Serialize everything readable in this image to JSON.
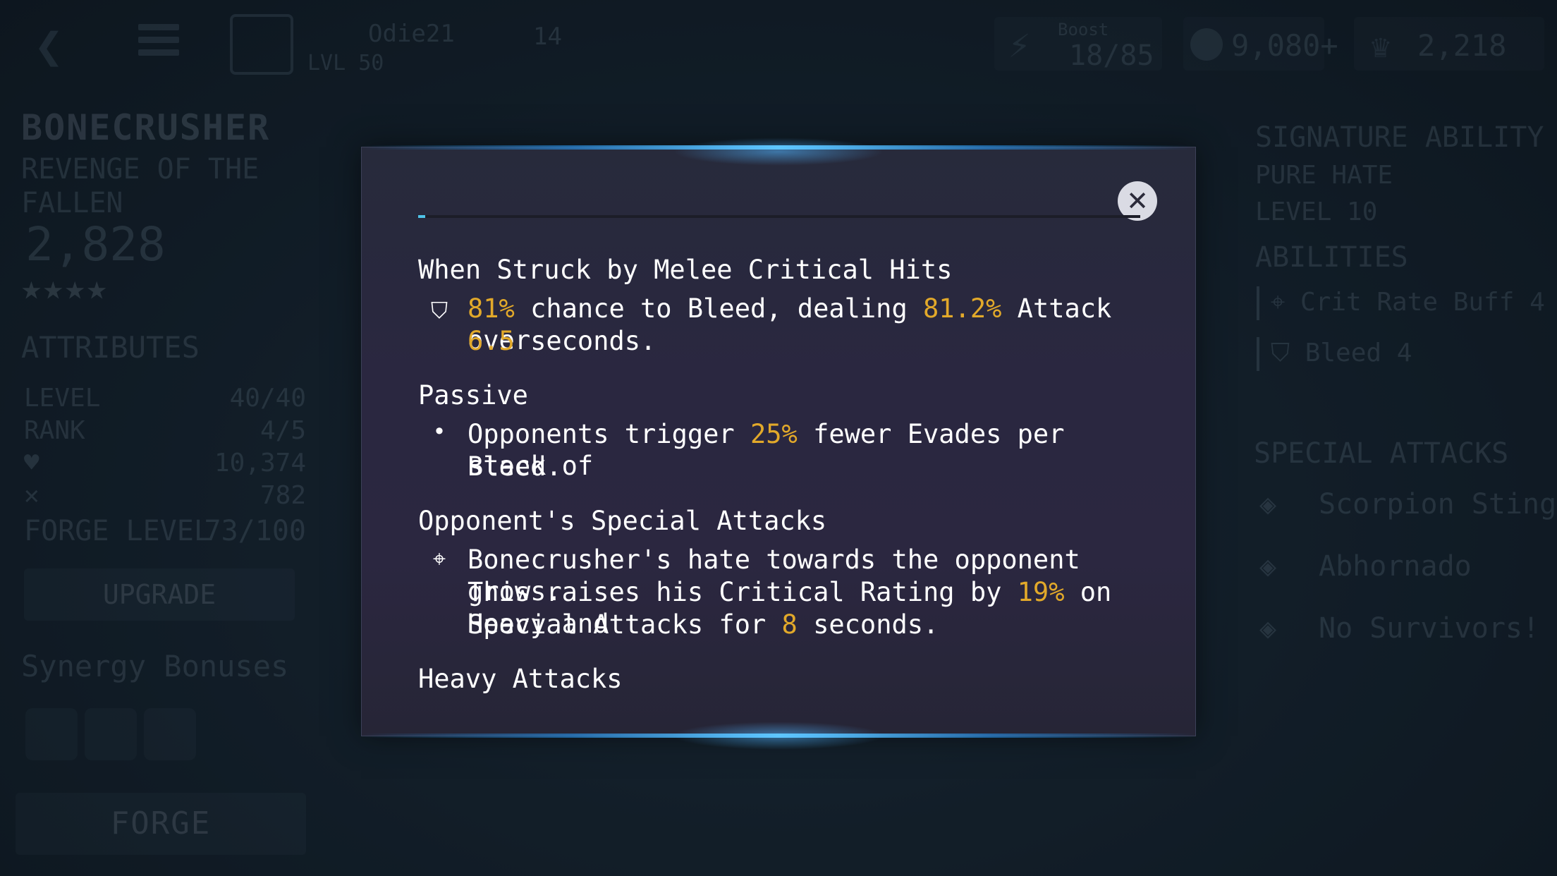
{
  "topbar": {
    "back_icon": "back-arrow-icon",
    "menu_icon": "menu-icon",
    "player_name": "Odie21",
    "player_level": "LVL 50",
    "player_number": "14",
    "energy": {
      "label": "Boost",
      "value": "18/85"
    },
    "gold_value": "9,080+",
    "units_value": "2,218"
  },
  "champion": {
    "name": "BONECRUSHER",
    "title": "REVENGE OF THE FALLEN",
    "power": "2,828",
    "stars": "★★★★",
    "attributes_title": "ATTRIBUTES",
    "attributes": [
      {
        "label": "LEVEL",
        "value": "40/40"
      },
      {
        "label": "RANK",
        "value": "4/5"
      },
      {
        "label": "♥",
        "value": "10,374"
      },
      {
        "label": "✕",
        "value": "782"
      }
    ],
    "forge_level_label": "FORGE LEVEL",
    "forge_level_value": "73/100",
    "upgrade_label": "UPGRADE",
    "synergy_title": "Synergy Bonuses",
    "forge_label": "FORGE"
  },
  "right_panel": {
    "signature_title": "SIGNATURE ABILITY",
    "signature_name": "PURE HATE",
    "signature_level": "LEVEL 10",
    "abilities_title": "ABILITIES",
    "abilities": [
      {
        "label": "Crit Rate Buff 4",
        "icon": "crosshair-icon"
      },
      {
        "label": "Bleed 4",
        "icon": "bleed-icon"
      }
    ],
    "special_title": "SPECIAL ATTACKS",
    "specials": [
      {
        "label": "Scorpion Sting"
      },
      {
        "label": "Abhornado"
      },
      {
        "label": "No Survivors!"
      }
    ]
  },
  "modal": {
    "close_icon": "close-icon",
    "sections": {
      "struck": {
        "title": "When Struck by Melee Critical Hits",
        "icon": "bleed-icon",
        "p1": "81%",
        "t1": " chance to Bleed, dealing ",
        "p2": "81.2%",
        "t2": " Attack over",
        "p3": "6.5",
        "t3": " seconds."
      },
      "passive": {
        "title": "Passive",
        "bullet": "•",
        "t1": "Opponents trigger ",
        "p1": "25%",
        "t2": " fewer Evades per stack of",
        "t3": "Bleed."
      },
      "specials": {
        "title": "Opponent's Special Attacks",
        "icon": "crosshair-icon",
        "line1": "Bonecrusher's hate towards the opponent grows.",
        "t2": "This raises his Critical Rating by ",
        "p1": "19%",
        "t3": " on Heavy and",
        "t4": "Special Attacks for ",
        "p2": "8",
        "t5": " seconds."
      },
      "heavy": {
        "title": "Heavy Attacks"
      }
    }
  },
  "colors": {
    "highlight": "#e2a92a",
    "glow": "#5ec6ff",
    "modal_bg": "#2a2740",
    "background": "#16232e"
  }
}
